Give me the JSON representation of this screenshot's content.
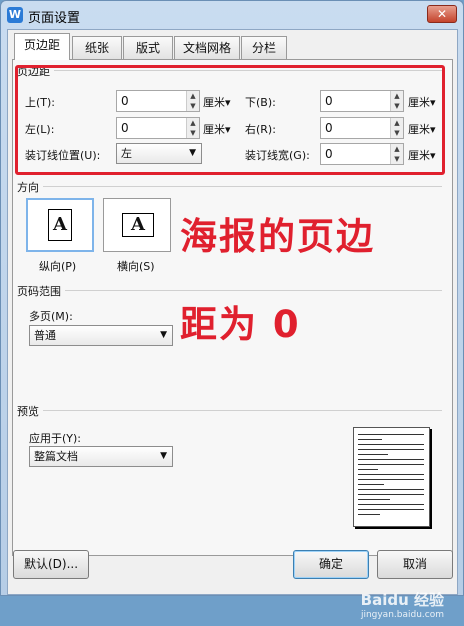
{
  "window": {
    "title": "页面设置",
    "app_icon_letter": "W",
    "close_glyph": "✕"
  },
  "tabs": [
    "页边距",
    "纸张",
    "版式",
    "文档网格",
    "分栏"
  ],
  "margins": {
    "group_label": "页边距",
    "top_label": "上(T):",
    "top_value": "0",
    "bottom_label": "下(B):",
    "bottom_value": "0",
    "left_label": "左(L):",
    "left_value": "0",
    "right_label": "右(R):",
    "right_value": "0",
    "gutter_pos_label": "装订线位置(U):",
    "gutter_pos_value": "左",
    "gutter_width_label": "装订线宽(G):",
    "gutter_width_value": "0",
    "unit": "厘米"
  },
  "orientation": {
    "group_label": "方向",
    "portrait_label": "纵向(P)",
    "landscape_label": "横向(S)",
    "paper_letter": "A"
  },
  "pages": {
    "group_label": "页码范围",
    "multi_label": "多页(M):",
    "multi_value": "普通"
  },
  "preview": {
    "group_label": "预览",
    "apply_label": "应用于(Y):",
    "apply_value": "整篇文档"
  },
  "buttons": {
    "default": "默认(D)...",
    "ok": "确定",
    "cancel": "取消"
  },
  "annotation": {
    "line1": "海报的页边",
    "line2": "距为 0",
    "color": "#e0202e"
  },
  "watermark": {
    "brand": "Baidu 经验",
    "url": "jingyan.baidu.com"
  }
}
